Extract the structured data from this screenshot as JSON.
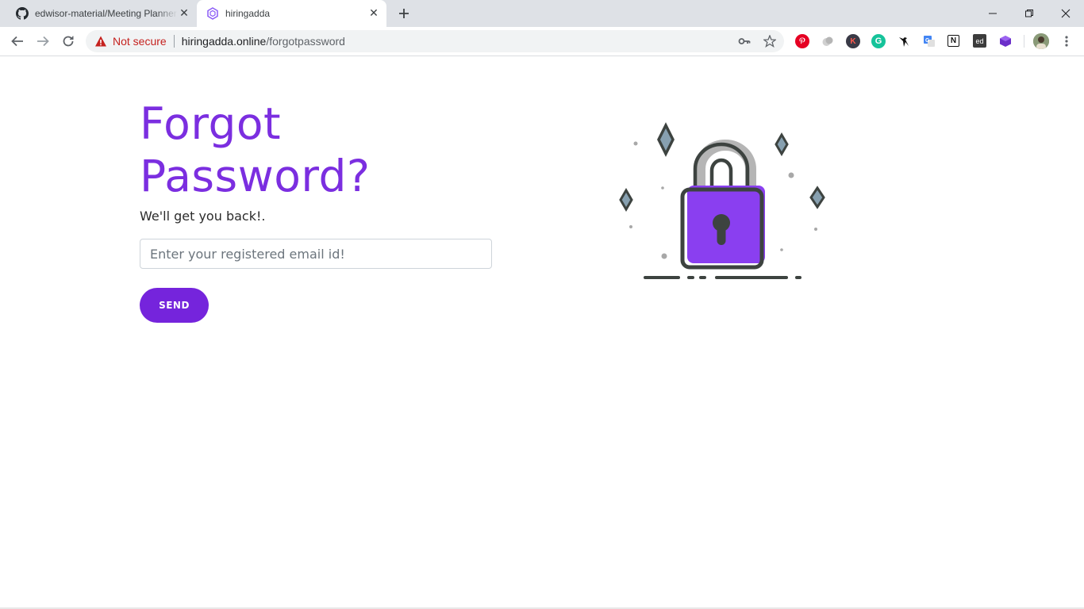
{
  "browser": {
    "tabs": [
      {
        "title": "edwisor-material/Meeting Planner",
        "favicon": "github-icon",
        "active": false
      },
      {
        "title": "hiringadda",
        "favicon": "hiringadda-logo-icon",
        "active": true
      }
    ],
    "omnibox": {
      "security_label": "Not secure",
      "url_host": "hiringadda.online",
      "url_path": "/forgotpassword"
    },
    "extensions": [
      "pinterest-icon",
      "extension-gray-icon",
      "k-extension-icon",
      "grammarly-icon",
      "bird-extension-icon",
      "google-translate-icon",
      "notion-icon",
      "ed-extension-icon",
      "cube-extension-icon"
    ],
    "extension_labels": {
      "k": "K",
      "g": "G",
      "n": "N",
      "ed": "ed"
    }
  },
  "page": {
    "heading": "Forgot Password?",
    "subtitle": "We'll get you back!.",
    "email_placeholder": "Enter your registered email id!",
    "send_label": "SEND",
    "illustration": "padlock-icon"
  },
  "colors": {
    "brand": "#7b2ee0",
    "button": "#7524dc",
    "not_secure": "#c5221f"
  }
}
